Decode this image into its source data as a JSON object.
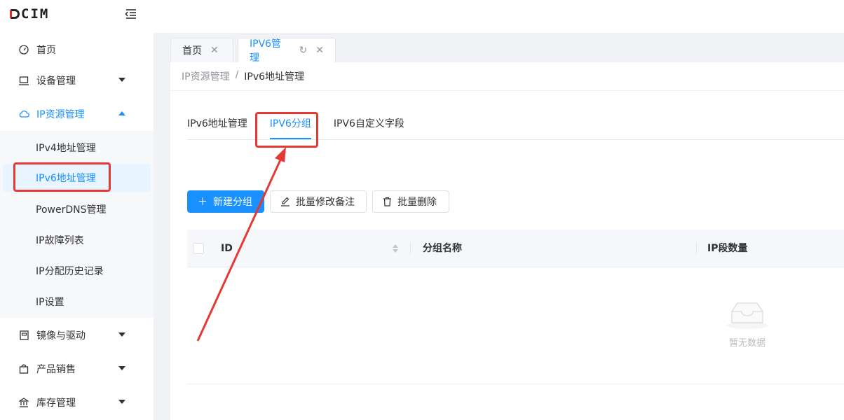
{
  "logo": {
    "text": "CIM"
  },
  "sidebar": {
    "items": [
      {
        "label": "首页",
        "icon": "dashboard-icon"
      },
      {
        "label": "设备管理",
        "icon": "monitor-icon"
      },
      {
        "label": "IP资源管理",
        "icon": "cloud-icon",
        "expanded": true
      },
      {
        "label": "镜像与驱动",
        "icon": "image-icon"
      },
      {
        "label": "产品销售",
        "icon": "bag-icon"
      },
      {
        "label": "库存管理",
        "icon": "bank-icon"
      }
    ],
    "subitems": [
      {
        "label": "IPv4地址管理"
      },
      {
        "label": "IPv6地址管理",
        "selected": true
      },
      {
        "label": "PowerDNS管理"
      },
      {
        "label": "IP故障列表"
      },
      {
        "label": "IP分配历史记录"
      },
      {
        "label": "IP设置"
      }
    ]
  },
  "tabs": [
    {
      "label": "首页"
    },
    {
      "label": "IPV6管理",
      "active": true
    }
  ],
  "breadcrumb": {
    "parent": "IP资源管理",
    "sep": "/",
    "current": "IPv6地址管理"
  },
  "subtabs": [
    {
      "label": "IPv6地址管理"
    },
    {
      "label": "IPV6分组",
      "active": true
    },
    {
      "label": "IPV6自定义字段"
    }
  ],
  "toolbar": {
    "new_group": "新建分组",
    "batch_edit_note": "批量修改备注",
    "batch_delete": "批量删除"
  },
  "table": {
    "columns": [
      "ID",
      "分组名称",
      "IP段数量"
    ],
    "empty_text": "暂无数据"
  },
  "colors": {
    "accent": "#1890ff",
    "annotation": "#e53935"
  }
}
